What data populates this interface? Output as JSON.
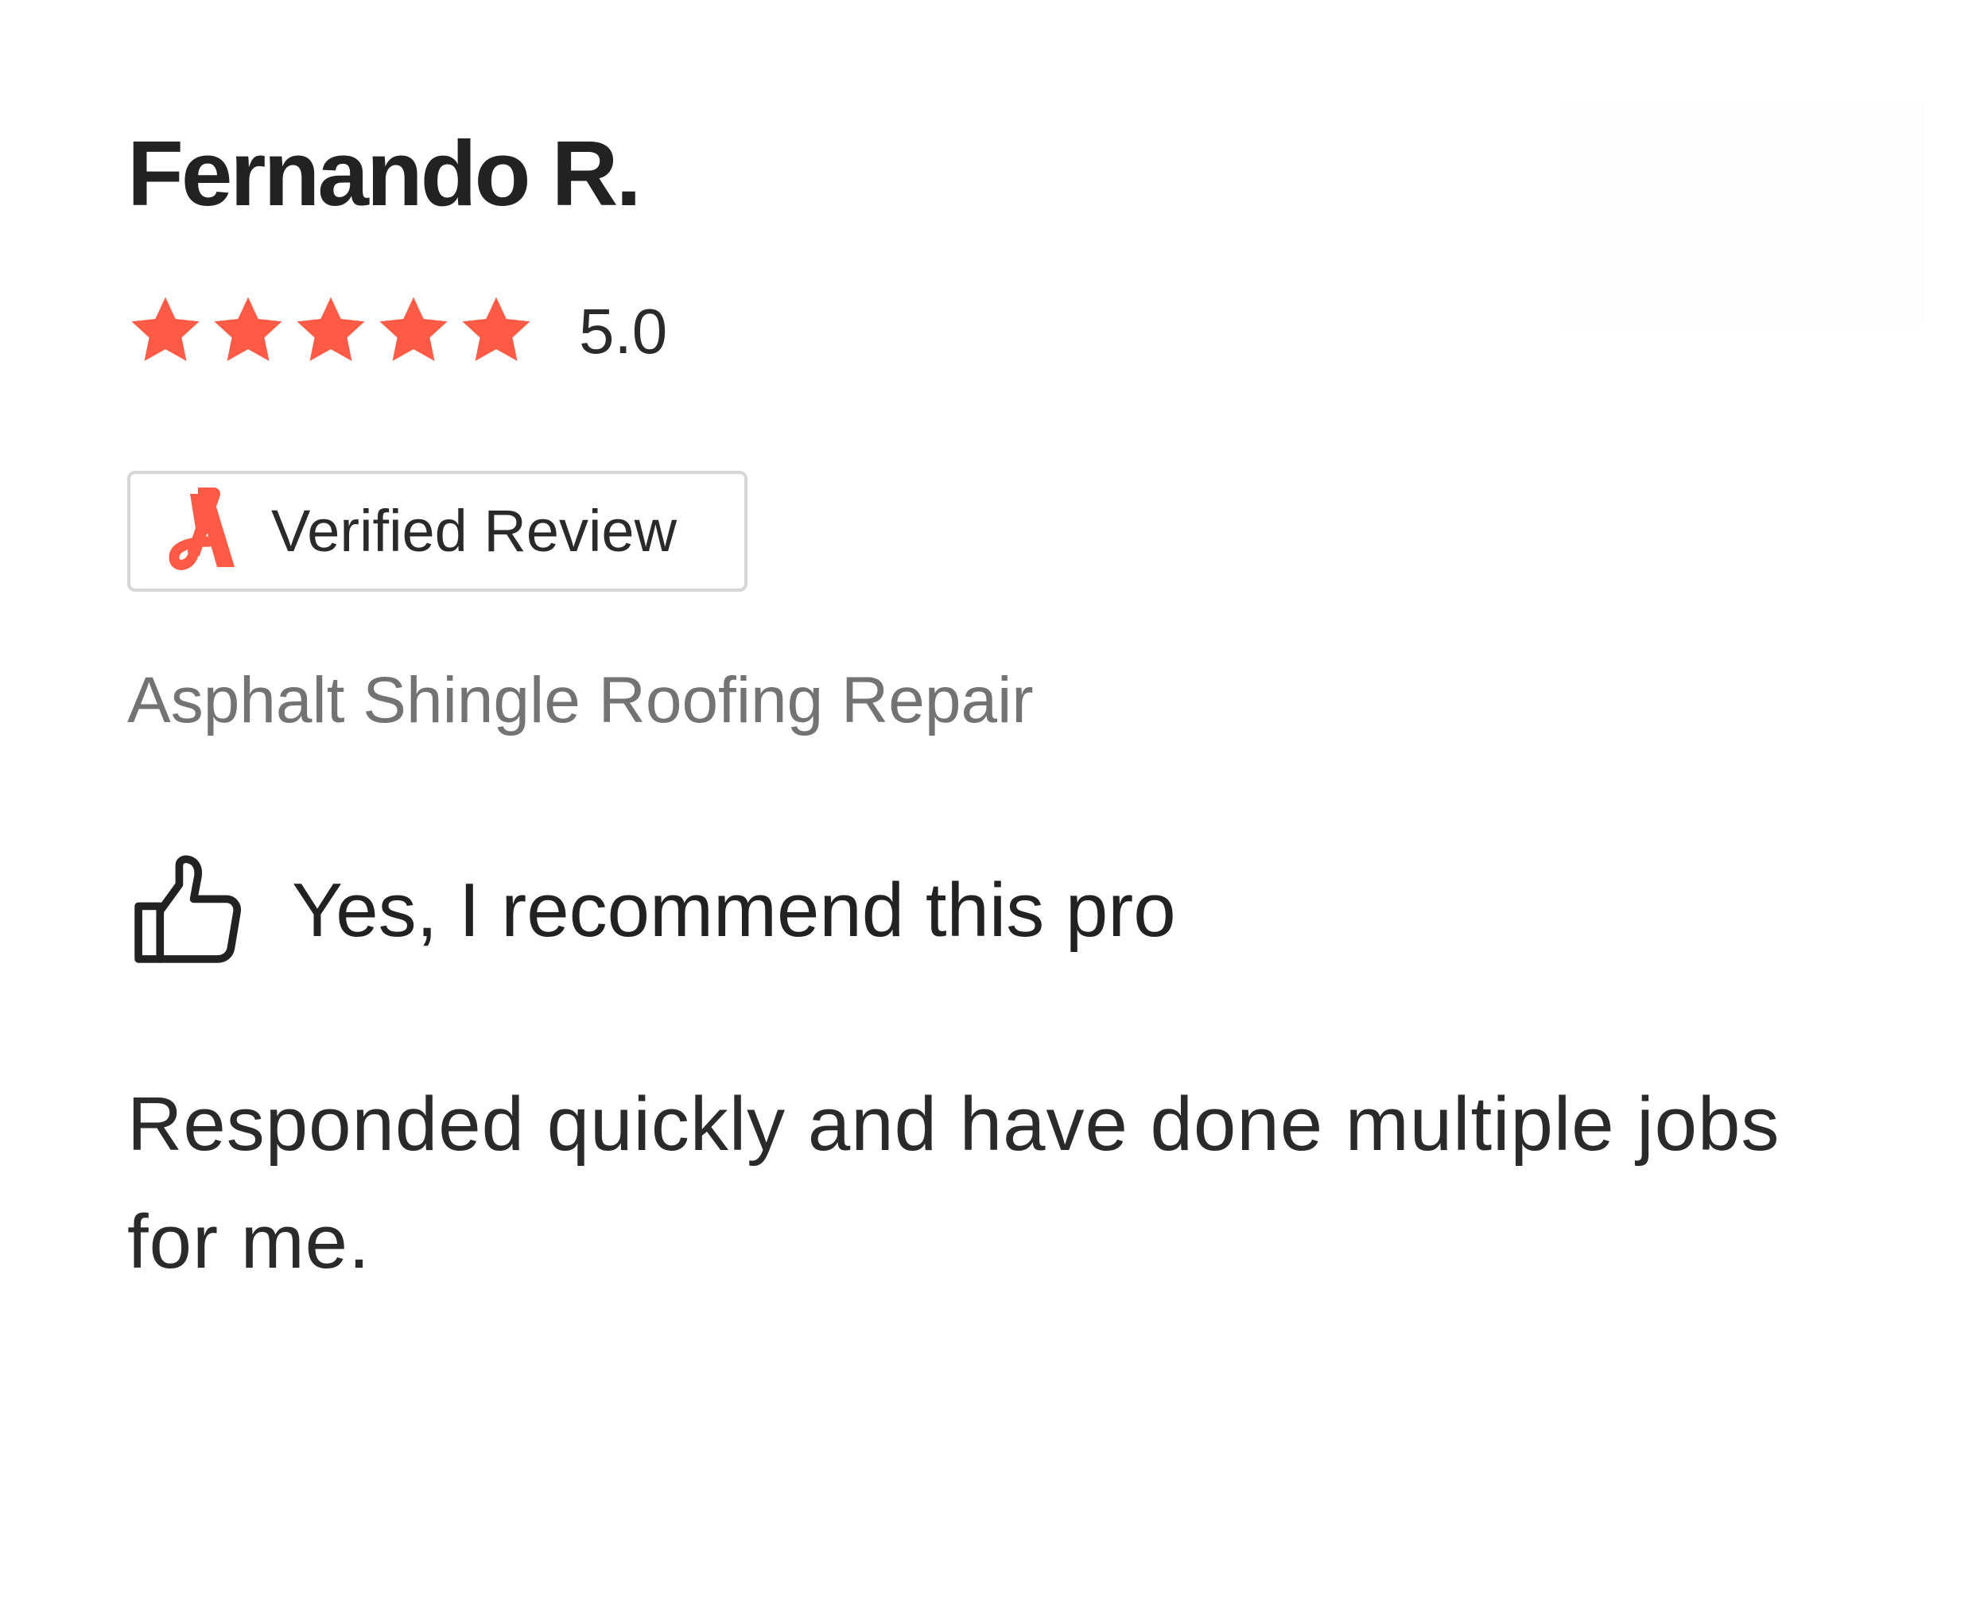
{
  "review": {
    "reviewer_name": "Fernando R.",
    "rating": {
      "value": 5.0,
      "display": "5.0",
      "max_stars": 5,
      "filled_stars": 5,
      "star_color": "#ff5a45"
    },
    "badge": {
      "label": "Verified Review",
      "logo_icon": "angi-logo-icon",
      "logo_color": "#ff5a45"
    },
    "service": "Asphalt Shingle Roofing Repair",
    "recommendation": {
      "icon": "thumbs-up-icon",
      "text": "Yes, I recommend this pro"
    },
    "body": "Responded quickly and have done multiple jobs for me."
  }
}
